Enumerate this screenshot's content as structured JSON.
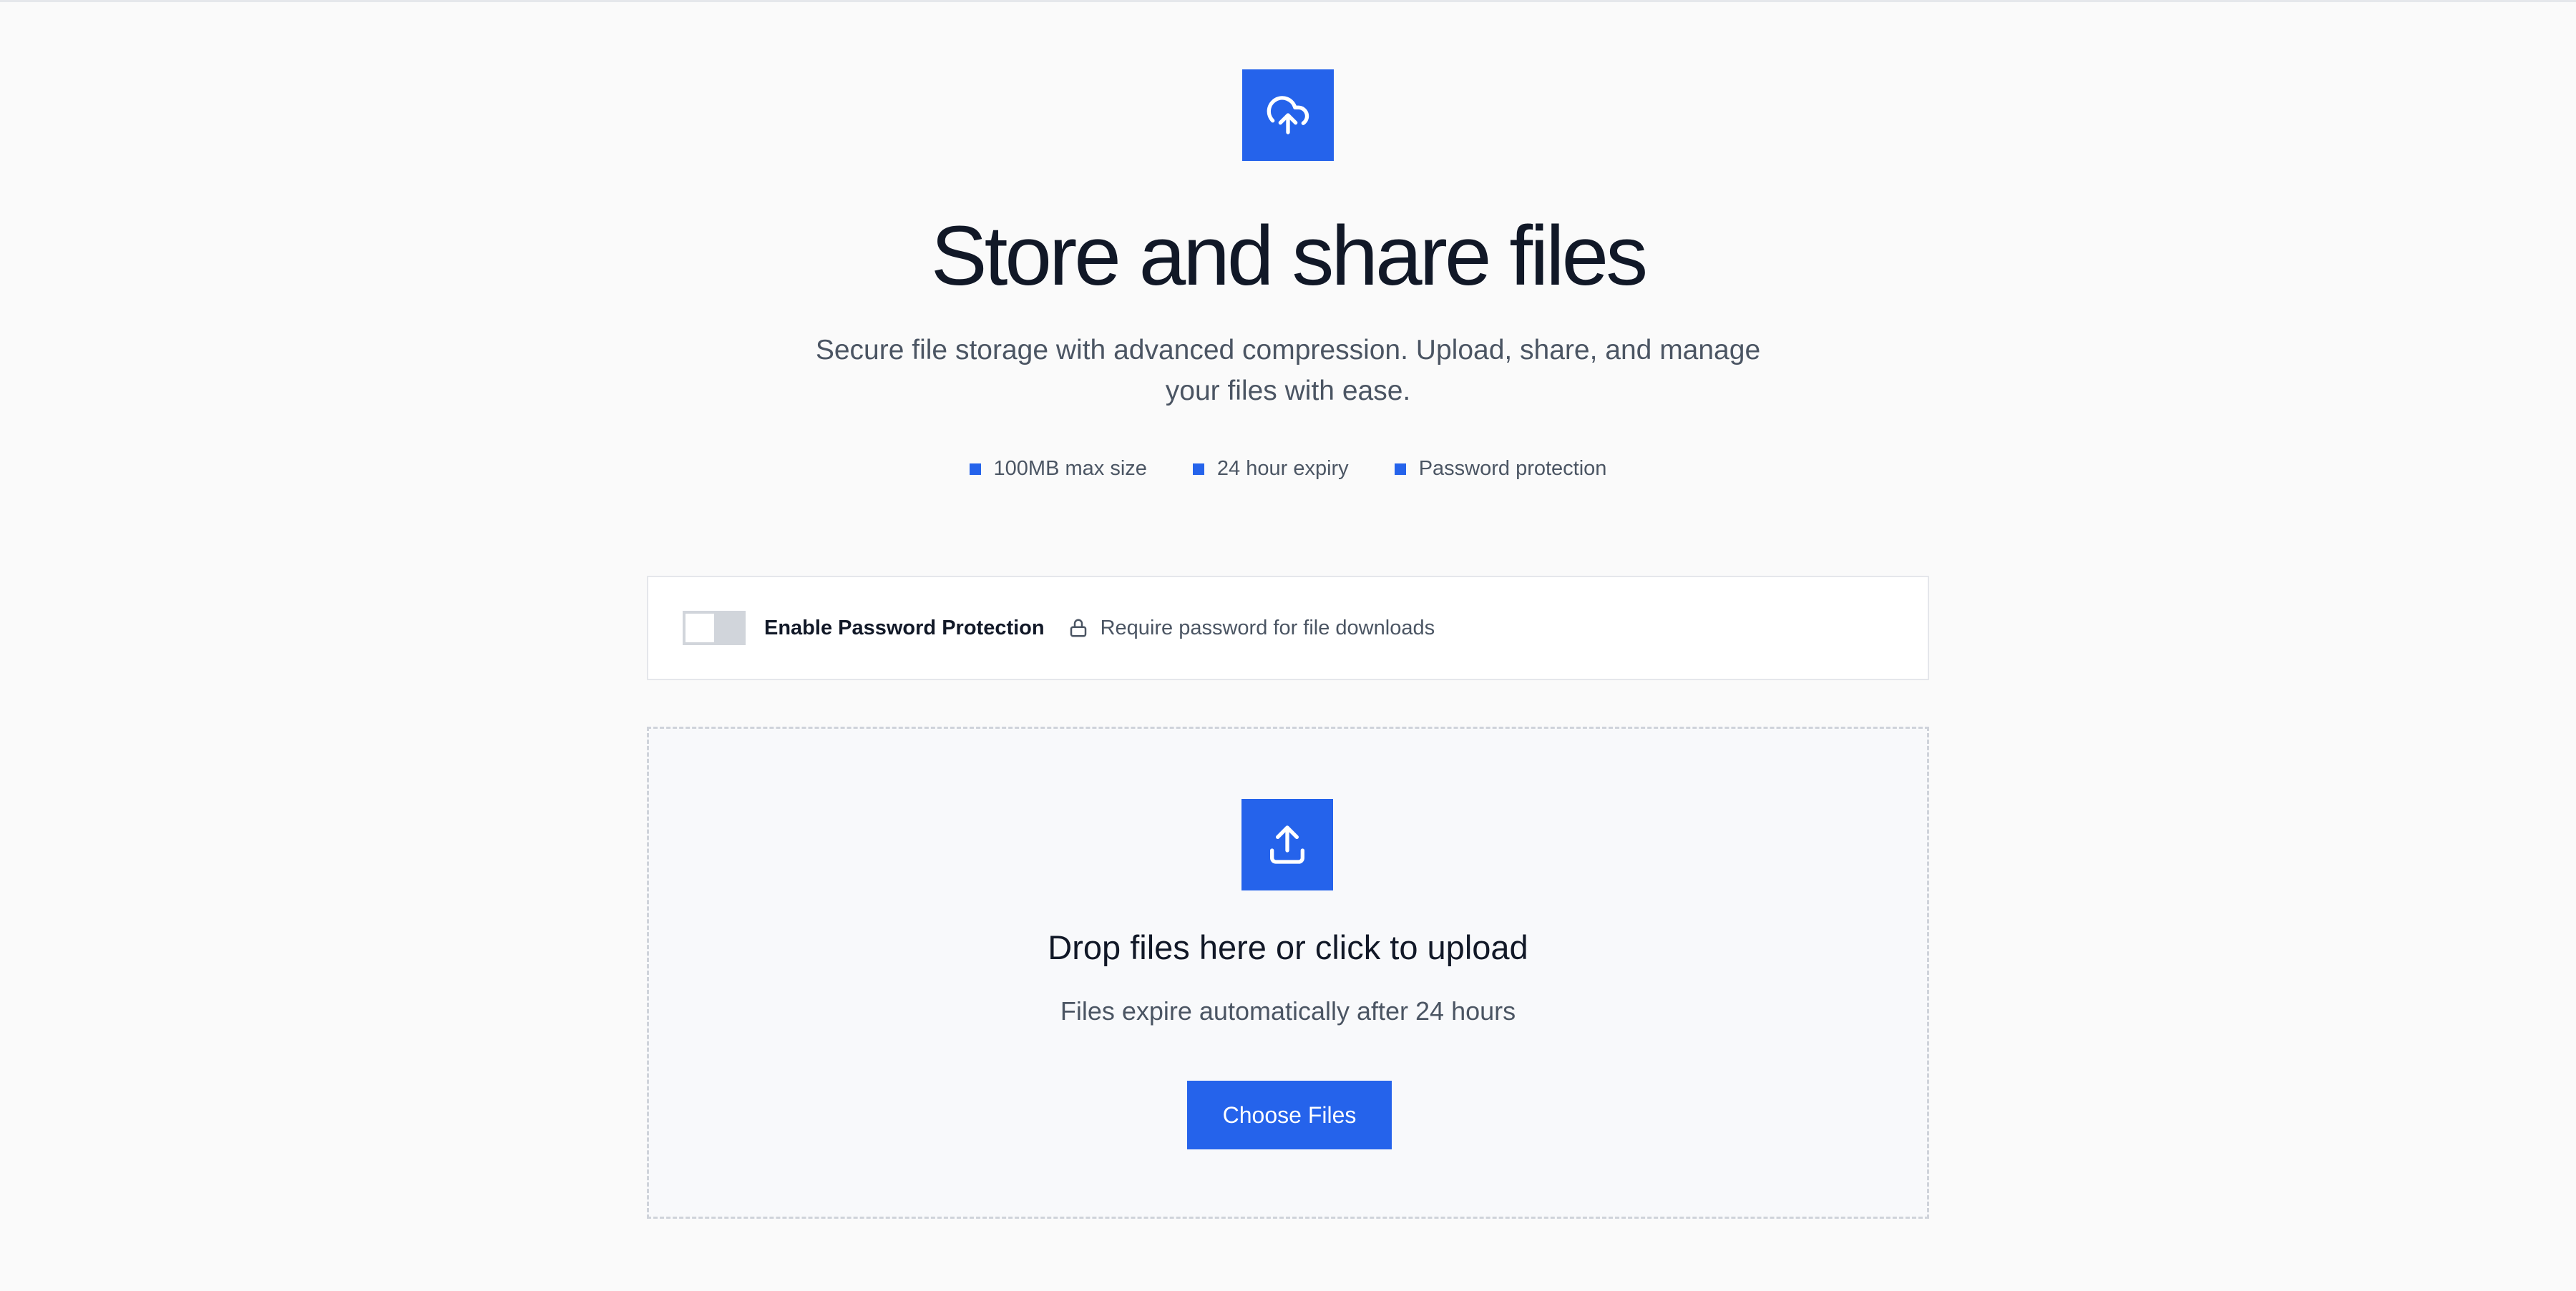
{
  "hero": {
    "icon": "cloud-upload-icon",
    "title": "Store and share files",
    "subtitle": "Secure file storage with advanced compression. Upload, share, and manage your files with ease.",
    "features": [
      "100MB max size",
      "24 hour expiry",
      "Password protection"
    ]
  },
  "password_protection": {
    "enabled": false,
    "toggle_label": "Enable Password Protection",
    "hint_icon": "lock-icon",
    "hint": "Require password for file downloads"
  },
  "dropzone": {
    "icon": "upload-icon",
    "title": "Drop files here or click to upload",
    "subtitle": "Files expire automatically after 24 hours",
    "button_label": "Choose Files"
  },
  "colors": {
    "accent": "#2563eb",
    "background": "#fafafa",
    "text_primary": "#111827",
    "text_secondary": "#4b5563"
  }
}
